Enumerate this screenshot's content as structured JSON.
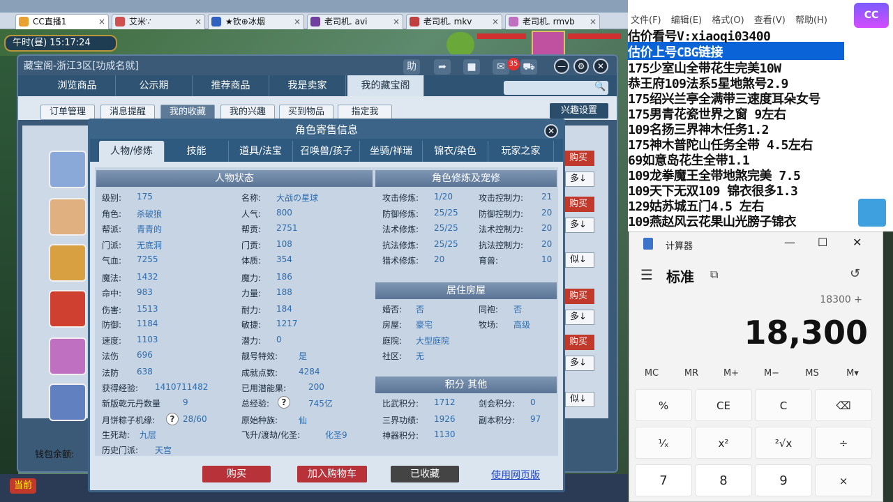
{
  "browser_tabs": [
    {
      "label": "CC直播1",
      "icon_color": "#e8a030",
      "active": true
    },
    {
      "label": "艾米∵",
      "icon_color": "#d05050"
    },
    {
      "label": "★钦⊕冰烟",
      "icon_color": "#3060c0"
    },
    {
      "label": "老司机. avi",
      "icon_color": "#7040a0"
    },
    {
      "label": "老司机. mkv",
      "icon_color": "#c04040"
    },
    {
      "label": "老司机. rmvb",
      "icon_color": "#c070c0"
    }
  ],
  "game": {
    "clock": "午时(昼)  15:17:24",
    "current_btn": "当前",
    "wallet_label": "钱包余额:"
  },
  "cbg_window": {
    "title": "藏宝阁-浙江3区[功成名就]",
    "help": "助",
    "cart_count": "35",
    "nav_tabs": [
      "浏览商品",
      "公示期",
      "推荐商品",
      "我是卖家",
      "我的藏宝阁"
    ],
    "nav_active": 4,
    "sub_tabs": [
      "订单管理",
      "消息提醒",
      "我的收藏",
      "我的兴趣",
      "买到物品",
      "指定我"
    ],
    "sub_active": 2,
    "interest_btn": "兴趣设置",
    "side_labels": {
      "buy": "购买",
      "more": "多↓",
      "similar": "似↓"
    }
  },
  "dialog": {
    "title": "角色寄售信息",
    "tabs": [
      "人物/修炼",
      "技能",
      "道具/法宝",
      "召唤兽/孩子",
      "坐骑/祥瑞",
      "锦衣/染色",
      "玩家之家"
    ],
    "active_tab": 0,
    "status_header": "人物状态",
    "left_col": [
      {
        "label": "级别:",
        "value": "175"
      },
      {
        "label": "角色:",
        "value": "杀破狼"
      },
      {
        "label": "帮派:",
        "value": "青青的"
      },
      {
        "label": "门派:",
        "value": "无底洞"
      },
      {
        "label": "气血:",
        "value": "7255"
      },
      {
        "label": "魔法:",
        "value": "1432"
      },
      {
        "label": "命中:",
        "value": "983"
      },
      {
        "label": "伤害:",
        "value": "1513"
      },
      {
        "label": "防御:",
        "value": "1184"
      },
      {
        "label": "速度:",
        "value": "1103"
      },
      {
        "label": "法伤",
        "value": "696"
      },
      {
        "label": "法防",
        "value": "638"
      },
      {
        "label": "获得经验:",
        "value": "1410711482"
      },
      {
        "label": "新版乾元丹数量",
        "value": "9"
      },
      {
        "label": "月饼粽子机缘:",
        "value": "28/60"
      },
      {
        "label": "生死劫:",
        "value": "九层"
      },
      {
        "label": "历史门派:",
        "value": "天宫"
      }
    ],
    "mid_col": [
      {
        "label": "名称:",
        "value": "大战の星球"
      },
      {
        "label": "人气:",
        "value": "800"
      },
      {
        "label": "帮贡:",
        "value": "2751"
      },
      {
        "label": "门贡:",
        "value": "108"
      },
      {
        "label": "体质:",
        "value": "354"
      },
      {
        "label": "魔力:",
        "value": "186"
      },
      {
        "label": "力量:",
        "value": "188"
      },
      {
        "label": "耐力:",
        "value": "184"
      },
      {
        "label": "敏捷:",
        "value": "1217"
      },
      {
        "label": "潜力:",
        "value": "0"
      },
      {
        "label": "靓号特效:",
        "value": "是"
      },
      {
        "label": "成就点数:",
        "value": "4284"
      },
      {
        "label": "已用潜能果:",
        "value": "200"
      },
      {
        "label": "总经验:",
        "value": "745亿"
      },
      {
        "label": "原始种族:",
        "value": "仙"
      },
      {
        "label": "飞升/渡劫/化圣:",
        "value": "化圣9"
      }
    ],
    "cultivation_header": "角色修炼及宠修",
    "cultivation": [
      {
        "l1": "攻击修炼:",
        "v1": "1/20",
        "l2": "攻击控制力:",
        "v2": "21"
      },
      {
        "l1": "防御修炼:",
        "v1": "25/25",
        "l2": "防御控制力:",
        "v2": "20"
      },
      {
        "l1": "法术修炼:",
        "v1": "25/25",
        "l2": "法术控制力:",
        "v2": "20"
      },
      {
        "l1": "抗法修炼:",
        "v1": "25/25",
        "l2": "抗法控制力:",
        "v2": "20"
      },
      {
        "l1": "猎术修炼:",
        "v1": "20",
        "l2": "育兽:",
        "v2": "10"
      }
    ],
    "house_header": "居住房屋",
    "house": [
      {
        "l1": "婚否:",
        "v1": "否",
        "l2": "同袍:",
        "v2": "否"
      },
      {
        "l1": "房屋:",
        "v1": "豪宅",
        "l2": "牧场:",
        "v2": "高级"
      },
      {
        "l1": "庭院:",
        "v1": "大型庭院"
      },
      {
        "l1": "社区:",
        "v1": "无"
      }
    ],
    "points_header": "积分 其他",
    "points": [
      {
        "l1": "比武积分:",
        "v1": "1712",
        "l2": "剑会积分:",
        "v2": "0"
      },
      {
        "l1": "三界功绩:",
        "v1": "1926",
        "l2": "副本积分:",
        "v2": "97"
      },
      {
        "l1": "神器积分:",
        "v1": "1130"
      }
    ],
    "buttons": {
      "buy": "购买",
      "cart": "加入购物车",
      "collected": "已收藏",
      "web": "使用网页版"
    }
  },
  "notepad": {
    "menu": [
      "文件(F)",
      "编辑(E)",
      "格式(O)",
      "查看(V)",
      "帮助(H)"
    ],
    "lines": [
      "估价看号V:xiaoqi03400",
      "估价上号CBG链接",
      "175少室山全带花生完美10W",
      "恭王府109法系5星地煞号2.9",
      "175绍兴兰亭全满带三速度耳朵女号",
      "175男青花瓷世界之窗  9左右",
      "109名扬三界神木任务1.2",
      "175神木普陀山任务全带 4.5左右",
      "69如意岛花生全带1.1",
      "109龙拳魔王全带地煞完美 7.5",
      "109天下无双109  锦衣很多1.3",
      "129姑苏城五门4.5 左右",
      "109燕赵风云花果山光膀子锦衣"
    ]
  },
  "calculator": {
    "title": "计算器",
    "mode": "标准",
    "expression": "18300 +",
    "display": "18,300",
    "memory": [
      "MC",
      "MR",
      "M+",
      "M−",
      "MS",
      "M▾"
    ],
    "keys": [
      [
        "%",
        "CE",
        "C",
        "⌫"
      ],
      [
        "¹⁄ₓ",
        "x²",
        "²√x",
        "÷"
      ],
      [
        "7",
        "8",
        "9",
        "×"
      ]
    ]
  }
}
